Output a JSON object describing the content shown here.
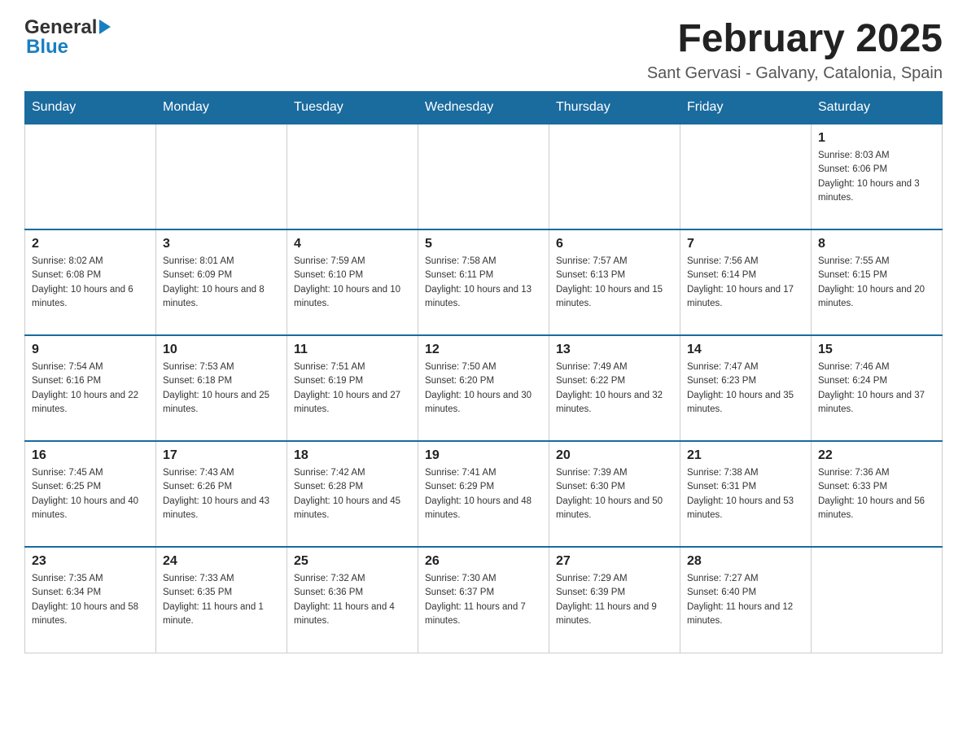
{
  "header": {
    "logo": {
      "general": "General",
      "blue": "Blue"
    },
    "title": "February 2025",
    "subtitle": "Sant Gervasi - Galvany, Catalonia, Spain"
  },
  "weekdays": [
    "Sunday",
    "Monday",
    "Tuesday",
    "Wednesday",
    "Thursday",
    "Friday",
    "Saturday"
  ],
  "weeks": [
    [
      {
        "day": "",
        "sunrise": "",
        "sunset": "",
        "daylight": ""
      },
      {
        "day": "",
        "sunrise": "",
        "sunset": "",
        "daylight": ""
      },
      {
        "day": "",
        "sunrise": "",
        "sunset": "",
        "daylight": ""
      },
      {
        "day": "",
        "sunrise": "",
        "sunset": "",
        "daylight": ""
      },
      {
        "day": "",
        "sunrise": "",
        "sunset": "",
        "daylight": ""
      },
      {
        "day": "",
        "sunrise": "",
        "sunset": "",
        "daylight": ""
      },
      {
        "day": "1",
        "sunrise": "Sunrise: 8:03 AM",
        "sunset": "Sunset: 6:06 PM",
        "daylight": "Daylight: 10 hours and 3 minutes."
      }
    ],
    [
      {
        "day": "2",
        "sunrise": "Sunrise: 8:02 AM",
        "sunset": "Sunset: 6:08 PM",
        "daylight": "Daylight: 10 hours and 6 minutes."
      },
      {
        "day": "3",
        "sunrise": "Sunrise: 8:01 AM",
        "sunset": "Sunset: 6:09 PM",
        "daylight": "Daylight: 10 hours and 8 minutes."
      },
      {
        "day": "4",
        "sunrise": "Sunrise: 7:59 AM",
        "sunset": "Sunset: 6:10 PM",
        "daylight": "Daylight: 10 hours and 10 minutes."
      },
      {
        "day": "5",
        "sunrise": "Sunrise: 7:58 AM",
        "sunset": "Sunset: 6:11 PM",
        "daylight": "Daylight: 10 hours and 13 minutes."
      },
      {
        "day": "6",
        "sunrise": "Sunrise: 7:57 AM",
        "sunset": "Sunset: 6:13 PM",
        "daylight": "Daylight: 10 hours and 15 minutes."
      },
      {
        "day": "7",
        "sunrise": "Sunrise: 7:56 AM",
        "sunset": "Sunset: 6:14 PM",
        "daylight": "Daylight: 10 hours and 17 minutes."
      },
      {
        "day": "8",
        "sunrise": "Sunrise: 7:55 AM",
        "sunset": "Sunset: 6:15 PM",
        "daylight": "Daylight: 10 hours and 20 minutes."
      }
    ],
    [
      {
        "day": "9",
        "sunrise": "Sunrise: 7:54 AM",
        "sunset": "Sunset: 6:16 PM",
        "daylight": "Daylight: 10 hours and 22 minutes."
      },
      {
        "day": "10",
        "sunrise": "Sunrise: 7:53 AM",
        "sunset": "Sunset: 6:18 PM",
        "daylight": "Daylight: 10 hours and 25 minutes."
      },
      {
        "day": "11",
        "sunrise": "Sunrise: 7:51 AM",
        "sunset": "Sunset: 6:19 PM",
        "daylight": "Daylight: 10 hours and 27 minutes."
      },
      {
        "day": "12",
        "sunrise": "Sunrise: 7:50 AM",
        "sunset": "Sunset: 6:20 PM",
        "daylight": "Daylight: 10 hours and 30 minutes."
      },
      {
        "day": "13",
        "sunrise": "Sunrise: 7:49 AM",
        "sunset": "Sunset: 6:22 PM",
        "daylight": "Daylight: 10 hours and 32 minutes."
      },
      {
        "day": "14",
        "sunrise": "Sunrise: 7:47 AM",
        "sunset": "Sunset: 6:23 PM",
        "daylight": "Daylight: 10 hours and 35 minutes."
      },
      {
        "day": "15",
        "sunrise": "Sunrise: 7:46 AM",
        "sunset": "Sunset: 6:24 PM",
        "daylight": "Daylight: 10 hours and 37 minutes."
      }
    ],
    [
      {
        "day": "16",
        "sunrise": "Sunrise: 7:45 AM",
        "sunset": "Sunset: 6:25 PM",
        "daylight": "Daylight: 10 hours and 40 minutes."
      },
      {
        "day": "17",
        "sunrise": "Sunrise: 7:43 AM",
        "sunset": "Sunset: 6:26 PM",
        "daylight": "Daylight: 10 hours and 43 minutes."
      },
      {
        "day": "18",
        "sunrise": "Sunrise: 7:42 AM",
        "sunset": "Sunset: 6:28 PM",
        "daylight": "Daylight: 10 hours and 45 minutes."
      },
      {
        "day": "19",
        "sunrise": "Sunrise: 7:41 AM",
        "sunset": "Sunset: 6:29 PM",
        "daylight": "Daylight: 10 hours and 48 minutes."
      },
      {
        "day": "20",
        "sunrise": "Sunrise: 7:39 AM",
        "sunset": "Sunset: 6:30 PM",
        "daylight": "Daylight: 10 hours and 50 minutes."
      },
      {
        "day": "21",
        "sunrise": "Sunrise: 7:38 AM",
        "sunset": "Sunset: 6:31 PM",
        "daylight": "Daylight: 10 hours and 53 minutes."
      },
      {
        "day": "22",
        "sunrise": "Sunrise: 7:36 AM",
        "sunset": "Sunset: 6:33 PM",
        "daylight": "Daylight: 10 hours and 56 minutes."
      }
    ],
    [
      {
        "day": "23",
        "sunrise": "Sunrise: 7:35 AM",
        "sunset": "Sunset: 6:34 PM",
        "daylight": "Daylight: 10 hours and 58 minutes."
      },
      {
        "day": "24",
        "sunrise": "Sunrise: 7:33 AM",
        "sunset": "Sunset: 6:35 PM",
        "daylight": "Daylight: 11 hours and 1 minute."
      },
      {
        "day": "25",
        "sunrise": "Sunrise: 7:32 AM",
        "sunset": "Sunset: 6:36 PM",
        "daylight": "Daylight: 11 hours and 4 minutes."
      },
      {
        "day": "26",
        "sunrise": "Sunrise: 7:30 AM",
        "sunset": "Sunset: 6:37 PM",
        "daylight": "Daylight: 11 hours and 7 minutes."
      },
      {
        "day": "27",
        "sunrise": "Sunrise: 7:29 AM",
        "sunset": "Sunset: 6:39 PM",
        "daylight": "Daylight: 11 hours and 9 minutes."
      },
      {
        "day": "28",
        "sunrise": "Sunrise: 7:27 AM",
        "sunset": "Sunset: 6:40 PM",
        "daylight": "Daylight: 11 hours and 12 minutes."
      },
      {
        "day": "",
        "sunrise": "",
        "sunset": "",
        "daylight": ""
      }
    ]
  ]
}
